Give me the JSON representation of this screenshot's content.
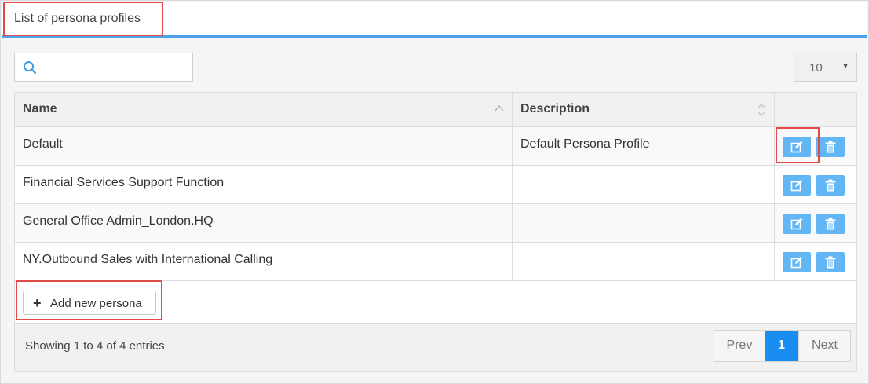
{
  "header": {
    "title": "List of persona profiles"
  },
  "search": {
    "value": "",
    "placeholder": ""
  },
  "page_size": {
    "selected": "10"
  },
  "table": {
    "columns": [
      {
        "label": "Name",
        "sort": "ascending"
      },
      {
        "label": "Description",
        "sort": "none"
      },
      {
        "label": ""
      }
    ],
    "rows": [
      {
        "name": "Default",
        "description": "Default Persona Profile"
      },
      {
        "name": "Financial Services Support Function",
        "description": ""
      },
      {
        "name": "General Office Admin_London.HQ",
        "description": ""
      },
      {
        "name": "NY.Outbound Sales with International Calling",
        "description": ""
      }
    ],
    "row_actions": [
      "edit-icon",
      "trash-icon"
    ]
  },
  "add_button": {
    "label": "Add new persona",
    "icon": "plus-icon"
  },
  "footer": {
    "info": "Showing 1 to 4 of 4 entries",
    "pagination": {
      "prev": "Prev",
      "current": "1",
      "next": "Next"
    }
  },
  "colors": {
    "accent": "#4aa3ea",
    "action_button": "#62b6f4",
    "active_page": "#1a8ef0",
    "highlight": "#e24a4a"
  }
}
